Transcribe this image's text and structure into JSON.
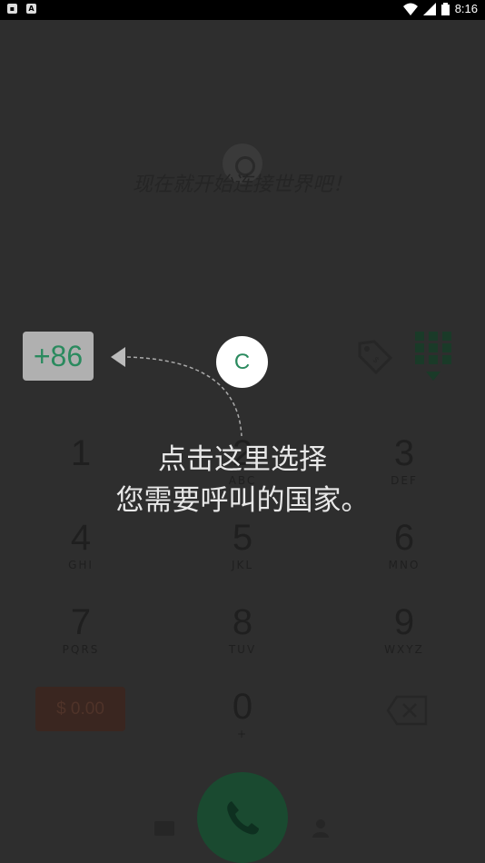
{
  "status_bar": {
    "time": "8:16",
    "left_icons": [
      "notification-icon",
      "a-icon"
    ],
    "right_icons": [
      "wifi-icon",
      "signal-icon",
      "battery-icon"
    ]
  },
  "welcome_text": "现在就开始连接世界吧！",
  "country_code": "+86",
  "keypad": [
    {
      "num": "1",
      "letters": ""
    },
    {
      "num": "2",
      "letters": "ABC"
    },
    {
      "num": "3",
      "letters": "DEF"
    },
    {
      "num": "4",
      "letters": "GHI"
    },
    {
      "num": "5",
      "letters": "JKL"
    },
    {
      "num": "6",
      "letters": "MNO"
    },
    {
      "num": "7",
      "letters": "PQRS"
    },
    {
      "num": "8",
      "letters": "TUV"
    },
    {
      "num": "9",
      "letters": "WXYZ"
    },
    {
      "num": "0",
      "letters": "+"
    }
  ],
  "balance": "$ 0.00",
  "tutorial": {
    "spot_label": "C",
    "tip_line1": "点击这里选择",
    "tip_line2": "您需要呼叫的国家。"
  },
  "colors": {
    "accent": "#2a8a5e",
    "overlay": "#2e2e2e"
  }
}
